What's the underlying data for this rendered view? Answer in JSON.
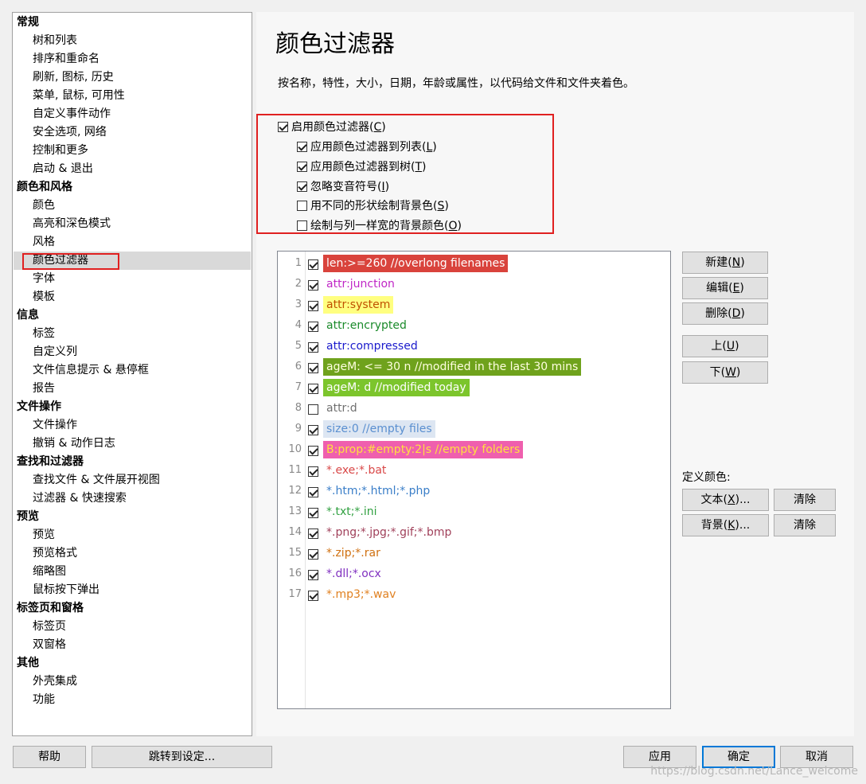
{
  "sidebar": {
    "items": [
      {
        "label": "常规",
        "group": true
      },
      {
        "label": "树和列表"
      },
      {
        "label": "排序和重命名"
      },
      {
        "label": "刷新, 图标, 历史"
      },
      {
        "label": "菜单, 鼠标, 可用性"
      },
      {
        "label": "自定义事件动作"
      },
      {
        "label": "安全选项, 网络"
      },
      {
        "label": "控制和更多"
      },
      {
        "label": "启动 & 退出"
      },
      {
        "label": "颜色和风格",
        "group": true
      },
      {
        "label": "颜色"
      },
      {
        "label": "高亮和深色模式"
      },
      {
        "label": "风格"
      },
      {
        "label": "颜色过滤器",
        "selected": true
      },
      {
        "label": "字体"
      },
      {
        "label": "模板"
      },
      {
        "label": "信息",
        "group": true
      },
      {
        "label": "标签"
      },
      {
        "label": "自定义列"
      },
      {
        "label": "文件信息提示 & 悬停框"
      },
      {
        "label": "报告"
      },
      {
        "label": "文件操作",
        "group": true
      },
      {
        "label": "文件操作"
      },
      {
        "label": "撤销 & 动作日志"
      },
      {
        "label": "查找和过滤器",
        "group": true
      },
      {
        "label": "查找文件 & 文件展开视图"
      },
      {
        "label": "过滤器 & 快速搜索"
      },
      {
        "label": "预览",
        "group": true
      },
      {
        "label": "预览"
      },
      {
        "label": "预览格式"
      },
      {
        "label": "缩略图"
      },
      {
        "label": "鼠标按下弹出"
      },
      {
        "label": "标签页和窗格",
        "group": true
      },
      {
        "label": "标签页"
      },
      {
        "label": "双窗格"
      },
      {
        "label": "其他",
        "group": true
      },
      {
        "label": "外壳集成"
      },
      {
        "label": "功能"
      }
    ]
  },
  "main": {
    "title": "颜色过滤器",
    "description": "按名称，特性，大小，日期，年龄或属性，以代码给文件和文件夹着色。",
    "options": [
      {
        "label": "启用颜色过滤器",
        "hotkey": "C",
        "checked": true
      },
      {
        "label": "应用颜色过滤器到列表",
        "hotkey": "L",
        "checked": true
      },
      {
        "label": "应用颜色过滤器到树",
        "hotkey": "T",
        "checked": true
      },
      {
        "label": "忽略变音符号",
        "hotkey": "I",
        "checked": true
      },
      {
        "label": "用不同的形状绘制背景色",
        "hotkey": "S",
        "checked": false
      },
      {
        "label": "绘制与列一样宽的背景颜色",
        "hotkey": "O",
        "checked": false
      }
    ]
  },
  "filters": [
    {
      "num": "1",
      "checked": true,
      "expr": "len:>=260 //overlong filenames",
      "fg": "#ffffff",
      "bg": "#d9433c"
    },
    {
      "num": "2",
      "checked": true,
      "expr": "attr:junction",
      "fg": "#c026c6",
      "bg": ""
    },
    {
      "num": "3",
      "checked": true,
      "expr": "attr:system",
      "fg": "#c05000",
      "bg": "#ffff80"
    },
    {
      "num": "4",
      "checked": true,
      "expr": "attr:encrypted",
      "fg": "#1a8a2a",
      "bg": ""
    },
    {
      "num": "5",
      "checked": true,
      "expr": "attr:compressed",
      "fg": "#1a1acc",
      "bg": ""
    },
    {
      "num": "6",
      "checked": true,
      "expr": "ageM: <= 30 n //modified in the last 30 mins",
      "fg": "#ffffe0",
      "bg": "#6fa21c"
    },
    {
      "num": "7",
      "checked": true,
      "expr": "ageM: d //modified today",
      "fg": "#ffffff",
      "bg": "#7cc52c"
    },
    {
      "num": "8",
      "checked": false,
      "expr": "attr:d",
      "fg": "#707070",
      "bg": ""
    },
    {
      "num": "9",
      "checked": true,
      "expr": "size:0 //empty files",
      "fg": "#5a8fd0",
      "bg": "#dde6f2"
    },
    {
      "num": "10",
      "checked": true,
      "expr": "B:prop:#empty:2|s //empty folders",
      "fg": "#ffe040",
      "bg": "#ef5fae"
    },
    {
      "num": "11",
      "checked": true,
      "expr": "*.exe;*.bat",
      "fg": "#d94848",
      "bg": ""
    },
    {
      "num": "12",
      "checked": true,
      "expr": "*.htm;*.html;*.php",
      "fg": "#3a7ec8",
      "bg": ""
    },
    {
      "num": "13",
      "checked": true,
      "expr": "*.txt;*.ini",
      "fg": "#30a040",
      "bg": ""
    },
    {
      "num": "14",
      "checked": true,
      "expr": "*.png;*.jpg;*.gif;*.bmp",
      "fg": "#a0405a",
      "bg": ""
    },
    {
      "num": "15",
      "checked": true,
      "expr": "*.zip;*.rar",
      "fg": "#d07010",
      "bg": ""
    },
    {
      "num": "16",
      "checked": true,
      "expr": "*.dll;*.ocx",
      "fg": "#8030c0",
      "bg": ""
    },
    {
      "num": "17",
      "checked": true,
      "expr": "*.mp3;*.wav",
      "fg": "#e08020",
      "bg": ""
    }
  ],
  "buttons": {
    "new": {
      "label": "新建",
      "hotkey": "N"
    },
    "edit": {
      "label": "编辑",
      "hotkey": "E"
    },
    "delete": {
      "label": "删除",
      "hotkey": "D"
    },
    "up": {
      "label": "上",
      "hotkey": "U"
    },
    "down": {
      "label": "下",
      "hotkey": "W"
    },
    "define_colors_label": "定义颜色:",
    "text": {
      "label": "文本",
      "hotkey": "X",
      "suffix": "..."
    },
    "text_clear": "清除",
    "background": {
      "label": "背景",
      "hotkey": "K",
      "suffix": "..."
    },
    "background_clear": "清除"
  },
  "footer": {
    "help": "帮助",
    "goto_setting": "跳转到设定...",
    "apply": "应用",
    "ok": "确定",
    "cancel": "取消"
  },
  "watermark": "https://blog.csdn.net/Lance_welcome",
  "colors": {
    "highlight_box": "#e02020",
    "primary_border": "#0078d7"
  }
}
